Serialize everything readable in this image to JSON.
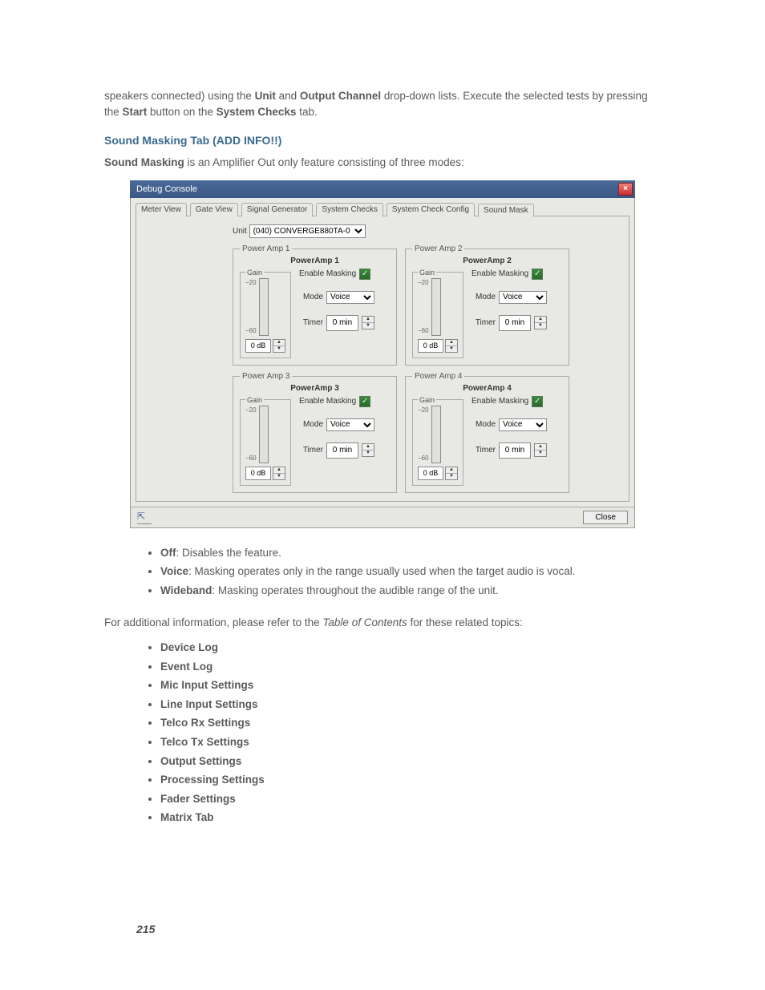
{
  "intro": {
    "prefix": "speakers connected) using the ",
    "bold1": "Unit",
    "mid1": " and ",
    "bold2": "Output Channel",
    "mid2": " drop-down lists. Execute the selected tests by pressing the ",
    "bold3": "Start",
    "mid3": " button on the ",
    "bold4": "System Checks",
    "suffix": " tab."
  },
  "heading": "Sound Masking Tab (ADD INFO!!)",
  "intro2": {
    "bold": "Sound Masking",
    "rest": " is an Amplifier Out only feature consisting of three modes:"
  },
  "dialog": {
    "title": "Debug Console",
    "tabs": [
      "Meter View",
      "Gate View",
      "Signal Generator",
      "System Checks",
      "System Check Config",
      "Sound Mask"
    ],
    "active_tab": 5,
    "unit_label": "Unit",
    "unit_value": "(040) CONVERGE880TA-0",
    "amps": [
      {
        "legend": "Power Amp 1",
        "title": "PowerAmp 1",
        "gain": "0 dB",
        "top": "−20",
        "bot": "−60",
        "enable": "Enable Masking",
        "mode_label": "Mode",
        "mode": "Voice",
        "timer_label": "Timer",
        "timer": "0 min"
      },
      {
        "legend": "Power Amp 2",
        "title": "PowerAmp 2",
        "gain": "0 dB",
        "top": "−20",
        "bot": "−60",
        "enable": "Enable Masking",
        "mode_label": "Mode",
        "mode": "Voice",
        "timer_label": "Timer",
        "timer": "0 min"
      },
      {
        "legend": "Power Amp 3",
        "title": "PowerAmp 3",
        "gain": "0 dB",
        "top": "−20",
        "bot": "−60",
        "enable": "Enable Masking",
        "mode_label": "Mode",
        "mode": "Voice",
        "timer_label": "Timer",
        "timer": "0 min"
      },
      {
        "legend": "Power Amp 4",
        "title": "PowerAmp 4",
        "gain": "0 dB",
        "top": "−20",
        "bot": "−60",
        "enable": "Enable Masking",
        "mode_label": "Mode",
        "mode": "Voice",
        "timer_label": "Timer",
        "timer": "0 min"
      }
    ],
    "gain_label": "Gain",
    "close": "Close"
  },
  "modes": [
    {
      "name": "Off",
      "desc": ": Disables the feature."
    },
    {
      "name": "Voice",
      "desc": ": Masking operates only in the range usually used when the target audio is vocal."
    },
    {
      "name": "Wideband",
      "desc": ": Masking operates throughout the audible range of the unit."
    }
  ],
  "additional": {
    "prefix": "For additional information, please refer to the ",
    "italic": "Table of Contents",
    "suffix": " for these related topics:"
  },
  "related": [
    "Device Log",
    "Event Log",
    "Mic Input Settings",
    "Line Input Settings",
    "Telco Rx Settings",
    "Telco Tx Settings",
    "Output Settings",
    "Processing Settings",
    "Fader Settings",
    "Matrix Tab"
  ],
  "page_number": "215"
}
